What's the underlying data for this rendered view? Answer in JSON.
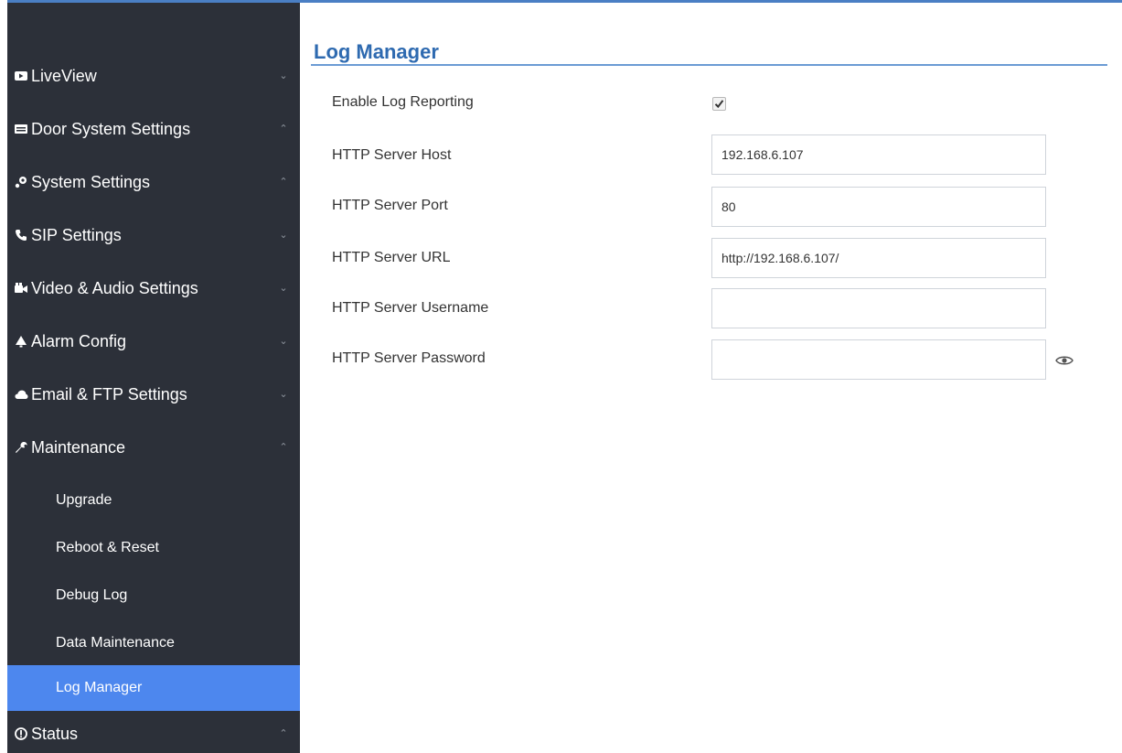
{
  "sidebar": {
    "items": [
      {
        "label": "LiveView",
        "icon": "liveview-icon",
        "chevron": "⌄"
      },
      {
        "label": "Door System Settings",
        "icon": "door-system-icon",
        "chevron": "⌃"
      },
      {
        "label": "System Settings",
        "icon": "system-settings-icon",
        "chevron": "⌃"
      },
      {
        "label": "SIP Settings",
        "icon": "phone-icon",
        "chevron": "⌄"
      },
      {
        "label": "Video & Audio Settings",
        "icon": "video-audio-icon",
        "chevron": "⌄"
      },
      {
        "label": "Alarm Config",
        "icon": "bell-icon",
        "chevron": "⌄"
      },
      {
        "label": "Email & FTP Settings",
        "icon": "cloud-icon",
        "chevron": "⌄"
      },
      {
        "label": "Maintenance",
        "icon": "wrench-icon",
        "chevron": "⌃"
      }
    ],
    "maintenance_subitems": [
      {
        "label": "Upgrade"
      },
      {
        "label": "Reboot & Reset"
      },
      {
        "label": "Debug Log"
      },
      {
        "label": "Data Maintenance"
      },
      {
        "label": "Log Manager",
        "active": true
      }
    ],
    "status": {
      "label": "Status",
      "icon": "info-circle-icon",
      "chevron": "⌃"
    }
  },
  "main": {
    "title": "Log Manager",
    "fields": {
      "enable_log_reporting": {
        "label": "Enable Log Reporting",
        "checked": true
      },
      "http_server_host": {
        "label": "HTTP Server Host",
        "value": "192.168.6.107"
      },
      "http_server_port": {
        "label": "HTTP Server Port",
        "value": "80"
      },
      "http_server_url": {
        "label": "HTTP Server URL",
        "value": "http://192.168.6.107/"
      },
      "http_server_username": {
        "label": "HTTP Server Username",
        "value": ""
      },
      "http_server_password": {
        "label": "HTTP Server Password",
        "value": ""
      }
    },
    "password_toggle_icon": "eye-icon"
  },
  "colors": {
    "sidebar_bg": "#2c3039",
    "active_item": "#4d87ee",
    "title": "#2e6ab0",
    "accent_line": "#6b9bd4"
  }
}
